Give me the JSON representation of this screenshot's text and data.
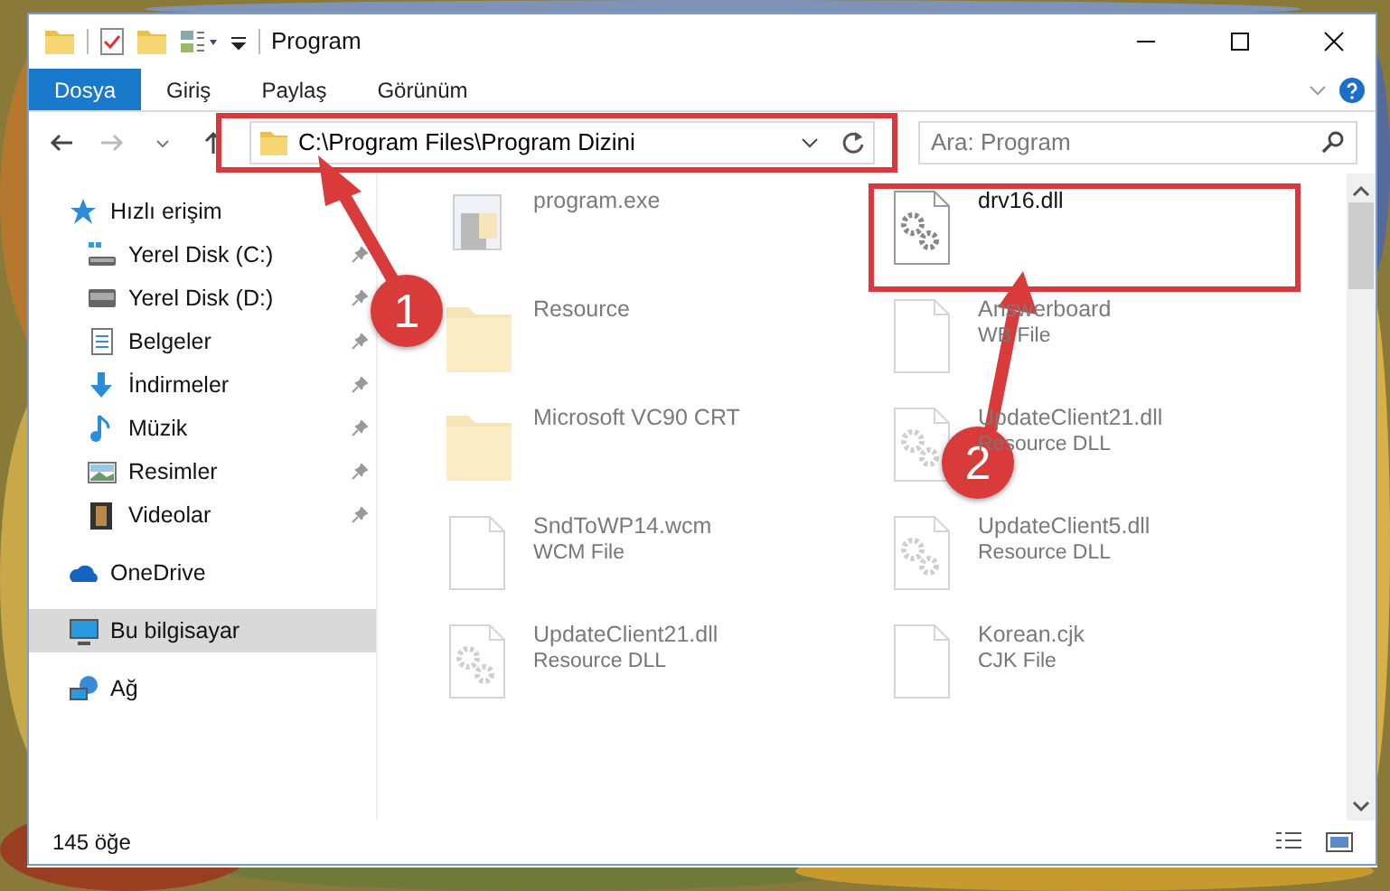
{
  "window": {
    "title": "Program"
  },
  "ribbon_tabs": [
    {
      "label": "Dosya",
      "selected": true
    },
    {
      "label": "Giriş",
      "selected": false
    },
    {
      "label": "Paylaş",
      "selected": false
    },
    {
      "label": "Görünüm",
      "selected": false
    }
  ],
  "address_bar": {
    "path": "C:\\Program Files\\Program Dizini"
  },
  "search": {
    "placeholder": "Ara: Program"
  },
  "sidebar": {
    "items": [
      {
        "label": "Hızlı erişim",
        "kind": "star",
        "selected": false,
        "children": [
          {
            "label": "Yerel Disk (C:)",
            "kind": "drive-c",
            "pinned": true,
            "selected": false
          },
          {
            "label": "Yerel Disk (D:)",
            "kind": "drive",
            "pinned": true,
            "selected": false
          },
          {
            "label": "Belgeler",
            "kind": "docs",
            "pinned": true,
            "selected": false
          },
          {
            "label": "İndirmeler",
            "kind": "download",
            "pinned": true,
            "selected": false
          },
          {
            "label": "Müzik",
            "kind": "music",
            "pinned": true,
            "selected": false
          },
          {
            "label": "Resimler",
            "kind": "pictures",
            "pinned": true,
            "selected": false
          },
          {
            "label": "Videolar",
            "kind": "videos",
            "pinned": true,
            "selected": false
          }
        ]
      },
      {
        "label": "OneDrive",
        "kind": "cloud",
        "selected": false
      },
      {
        "label": "Bu bilgisayar",
        "kind": "computer",
        "selected": true
      },
      {
        "label": "Ağ",
        "kind": "network",
        "selected": false
      }
    ]
  },
  "files": [
    {
      "name": "program.exe",
      "kind": "exe",
      "dimmed": true
    },
    {
      "name": "drv16.dll",
      "kind": "dll",
      "dimmed": false
    },
    {
      "name": "Resource",
      "kind": "folder",
      "dimmed": true
    },
    {
      "name": "Answerboard",
      "type": "WB File",
      "kind": "file",
      "dimmed": true
    },
    {
      "name": "Microsoft VC90 CRT",
      "kind": "folder",
      "dimmed": true
    },
    {
      "name": "UpdateClient21.dll",
      "type": "Resource DLL",
      "kind": "dll",
      "dimmed": true
    },
    {
      "name": "SndToWP14.wcm",
      "type": "WCM File",
      "kind": "file",
      "dimmed": true
    },
    {
      "name": "UpdateClient5.dll",
      "type": "Resource DLL",
      "kind": "dll",
      "dimmed": true
    },
    {
      "name": "UpdateClient21.dll",
      "type": "Resource DLL",
      "kind": "dll",
      "dimmed": true
    },
    {
      "name": "Korean.cjk",
      "type": "CJK File",
      "kind": "file",
      "dimmed": true
    }
  ],
  "status_bar": {
    "count": "145 öğe"
  },
  "annotations": [
    {
      "number": "1"
    },
    {
      "number": "2"
    }
  ]
}
